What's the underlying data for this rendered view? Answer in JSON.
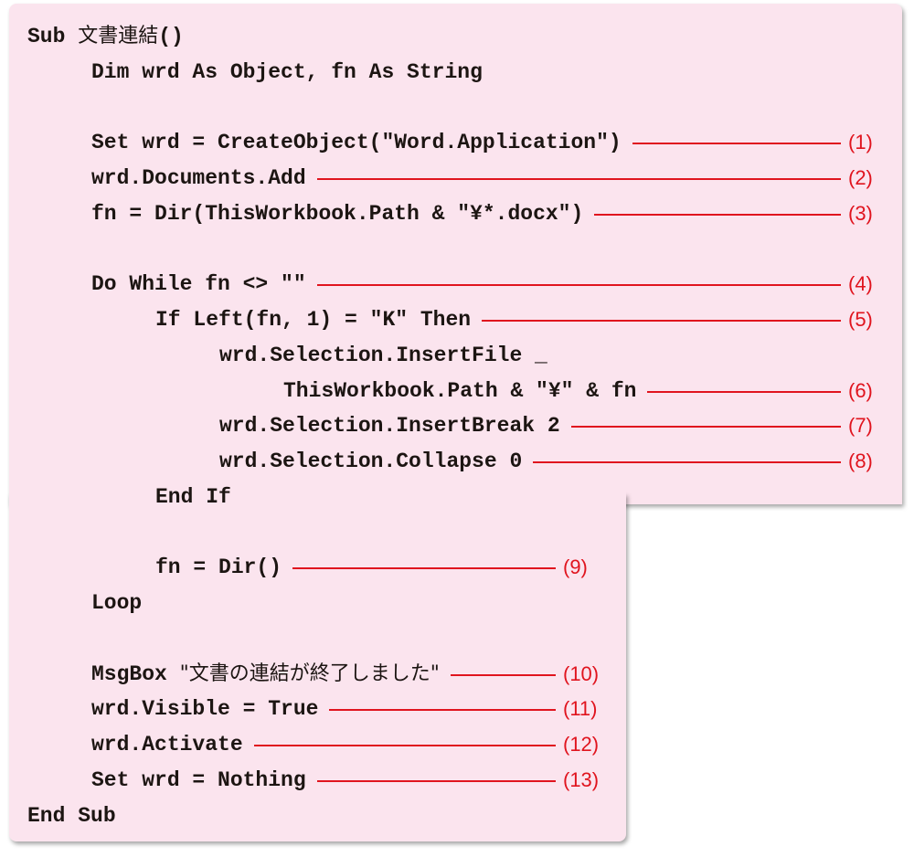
{
  "code": {
    "language": "VBA",
    "lines": [
      {
        "indent": 0,
        "text": "Sub ",
        "jp": "文書連結",
        "tail": "()"
      },
      {
        "indent": 1,
        "text": "Dim wrd As Object, fn As String"
      },
      {
        "indent": 0,
        "text": ""
      },
      {
        "indent": 1,
        "text": "Set wrd = CreateObject(\"Word.Application\")",
        "marker": "(1)"
      },
      {
        "indent": 1,
        "text": "wrd.Documents.Add",
        "marker": "(2)"
      },
      {
        "indent": 1,
        "text": "fn = Dir(ThisWorkbook.Path & \"¥*.docx\")",
        "marker": "(3)"
      },
      {
        "indent": 0,
        "text": ""
      },
      {
        "indent": 1,
        "text": "Do While fn <> \"\"",
        "marker": "(4)"
      },
      {
        "indent": 2,
        "text": "If Left(fn, 1) = \"K\" Then",
        "marker": "(5)"
      },
      {
        "indent": 3,
        "text": "wrd.Selection.InsertFile _"
      },
      {
        "indent": 4,
        "text": "ThisWorkbook.Path & \"¥\" & fn",
        "marker": "(6)"
      },
      {
        "indent": 3,
        "text": "wrd.Selection.InsertBreak 2",
        "marker": "(7)"
      },
      {
        "indent": 3,
        "text": "wrd.Selection.Collapse 0",
        "marker": "(8)"
      },
      {
        "indent": 2,
        "text": "End If"
      },
      {
        "indent": 0,
        "text": ""
      },
      {
        "indent": 2,
        "text": "fn = Dir()",
        "marker": "(9)"
      },
      {
        "indent": 1,
        "text": "Loop"
      },
      {
        "indent": 0,
        "text": ""
      },
      {
        "indent": 1,
        "text": "MsgBox ",
        "jp": "\"文書の連結が終了しました\"",
        "marker": "(10)"
      },
      {
        "indent": 1,
        "text": "wrd.Visible = True",
        "marker": "(11)"
      },
      {
        "indent": 1,
        "text": "wrd.Activate",
        "marker": "(12)"
      },
      {
        "indent": 1,
        "text": "Set wrd = Nothing",
        "marker": "(13)"
      },
      {
        "indent": 0,
        "text": "End Sub"
      }
    ]
  },
  "colors": {
    "panel_background": "#fbe4ee",
    "code_text": "#1c1512",
    "annotation": "#e0141e"
  }
}
